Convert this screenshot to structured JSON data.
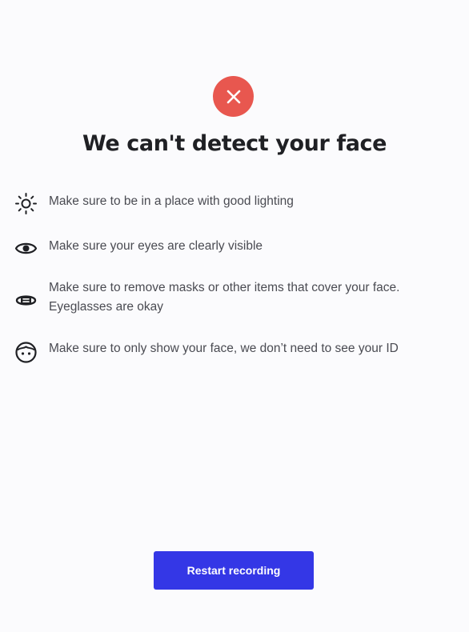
{
  "status": {
    "icon": "close-icon",
    "color": "#e8574f"
  },
  "title": "We can't detect your face",
  "tips": [
    {
      "icon": "sun-icon",
      "text": "Make sure to be in a place with good lighting"
    },
    {
      "icon": "eye-icon",
      "text": "Make sure your eyes are clearly visible"
    },
    {
      "icon": "mask-icon",
      "text": "Make sure to remove masks or other items that cover your face. Eyeglasses are okay"
    },
    {
      "icon": "face-icon",
      "text": "Make sure to only show your face, we don’t need to see your ID"
    }
  ],
  "actions": {
    "restart_label": "Restart recording",
    "accent": "#3437e6"
  }
}
